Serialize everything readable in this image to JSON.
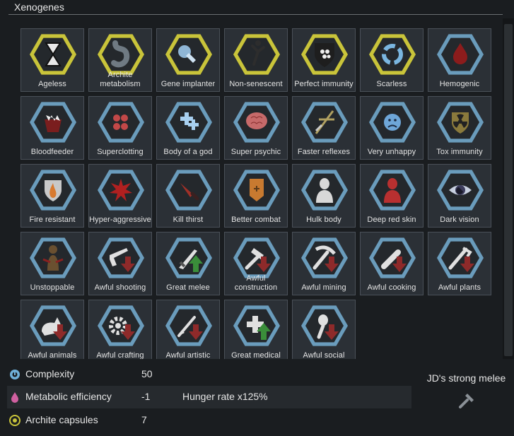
{
  "header": {
    "title": "Xenogenes"
  },
  "genes": [
    {
      "label": "Ageless",
      "icon": "hourglass-icon",
      "ring": "#c9c43a",
      "fill": "#e8e8e8"
    },
    {
      "label": "Archite metabolism",
      "icon": "stomach-icon",
      "ring": "#c9c43a",
      "fill": "#6f7a83"
    },
    {
      "label": "Gene implanter",
      "icon": "implanter-icon",
      "ring": "#c9c43a",
      "fill": "#8fb6d6"
    },
    {
      "label": "Non-senescent",
      "icon": "figure-icon",
      "ring": "#c9c43a",
      "fill": "#2d2d2d"
    },
    {
      "label": "Perfect immunity",
      "icon": "shield-dots-icon",
      "ring": "#c9c43a",
      "fill": "#1e1e1e"
    },
    {
      "label": "Scarless",
      "icon": "cycle-icon",
      "ring": "#c9c43a",
      "fill": "#7ab6e0"
    },
    {
      "label": "Hemogenic",
      "icon": "blood-drop-icon",
      "ring": "#6a9cbc",
      "fill": "#8c1c1c"
    },
    {
      "label": "Bloodfeeder",
      "icon": "fangs-icon",
      "ring": "#6a9cbc",
      "fill": "#7a1e1e"
    },
    {
      "label": "Superclotting",
      "icon": "cells-icon",
      "ring": "#6a9cbc",
      "fill": "#c24848"
    },
    {
      "label": "Body of a god",
      "icon": "crosses-icon",
      "ring": "#6a9cbc",
      "fill": "#a8d0f0"
    },
    {
      "label": "Super psychic",
      "icon": "brain-icon",
      "ring": "#6a9cbc",
      "fill": "#c76a6a"
    },
    {
      "label": "Faster reflexes",
      "icon": "reflex-icon",
      "ring": "#6a9cbc",
      "fill": "#b0a060"
    },
    {
      "label": "Very unhappy",
      "icon": "sad-face-icon",
      "ring": "#6a9cbc",
      "fill": "#6ea6d8"
    },
    {
      "label": "Tox immunity",
      "icon": "radiation-icon",
      "ring": "#6a9cbc",
      "fill": "#8a7a3c"
    },
    {
      "label": "Fire resistant",
      "icon": "flame-shield-icon",
      "ring": "#6a9cbc",
      "fill": "#d87a30"
    },
    {
      "label": "Hyper-aggressive",
      "icon": "burst-icon",
      "ring": "#6a9cbc",
      "fill": "#b02020"
    },
    {
      "label": "Kill thirst",
      "icon": "knife-icon",
      "ring": "#6a9cbc",
      "fill": "#a03028"
    },
    {
      "label": "Better combat",
      "icon": "banner-icon",
      "ring": "#6a9cbc",
      "fill": "#c87a30"
    },
    {
      "label": "Hulk body",
      "icon": "bust-white-icon",
      "ring": "#6a9cbc",
      "fill": "#d8d8d8"
    },
    {
      "label": "Deep red skin",
      "icon": "bust-red-icon",
      "ring": "#6a9cbc",
      "fill": "#b83030"
    },
    {
      "label": "Dark vision",
      "icon": "eye-icon",
      "ring": "#6a9cbc",
      "fill": "#3c3c5c"
    },
    {
      "label": "Unstoppable",
      "icon": "breaking-chains-icon",
      "ring": "#6a9cbc",
      "fill": "#6a5030"
    },
    {
      "label": "Awful shooting",
      "icon": "rifle-down-icon",
      "ring": "#6a9cbc",
      "fill": "#e0e0e0"
    },
    {
      "label": "Great melee",
      "icon": "sword-up-icon",
      "ring": "#6a9cbc",
      "fill": "#e0e0e0"
    },
    {
      "label": "Awful construction",
      "icon": "hammer-down-icon",
      "ring": "#6a9cbc",
      "fill": "#e0e0e0"
    },
    {
      "label": "Awful mining",
      "icon": "pickaxe-down-icon",
      "ring": "#6a9cbc",
      "fill": "#e0e0e0"
    },
    {
      "label": "Awful cooking",
      "icon": "pin-down-icon",
      "ring": "#6a9cbc",
      "fill": "#e0e0e0"
    },
    {
      "label": "Awful plants",
      "icon": "hoe-down-icon",
      "ring": "#6a9cbc",
      "fill": "#e0e0e0"
    },
    {
      "label": "Awful animals",
      "icon": "animal-down-icon",
      "ring": "#6a9cbc",
      "fill": "#e0e0e0"
    },
    {
      "label": "Awful crafting",
      "icon": "gear-down-icon",
      "ring": "#6a9cbc",
      "fill": "#e0e0e0"
    },
    {
      "label": "Awful artistic",
      "icon": "brush-down-icon",
      "ring": "#6a9cbc",
      "fill": "#e0e0e0"
    },
    {
      "label": "Great medical",
      "icon": "medical-up-icon",
      "ring": "#6a9cbc",
      "fill": "#e0e0e0"
    },
    {
      "label": "Awful social",
      "icon": "microphone-down-icon",
      "ring": "#6a9cbc",
      "fill": "#e0e0e0"
    }
  ],
  "colors": {
    "arrow_down": "#8e2a2a",
    "arrow_up": "#3a8e3a",
    "hex_inner": "#24282c"
  },
  "stats": {
    "complexity": {
      "label": "Complexity",
      "value": "50",
      "icon": "complexity-icon",
      "color": "#6fb0d8"
    },
    "metabolic": {
      "label": "Metabolic efficiency",
      "value": "-1",
      "note": "Hunger rate x125%",
      "icon": "metabolism-icon",
      "color": "#d060a0"
    },
    "archite": {
      "label": "Archite capsules",
      "value": "7",
      "icon": "archite-icon",
      "color": "#c9c43a"
    }
  },
  "xenotype": {
    "name": "JD's strong melee",
    "icon": "hammer-icon"
  }
}
